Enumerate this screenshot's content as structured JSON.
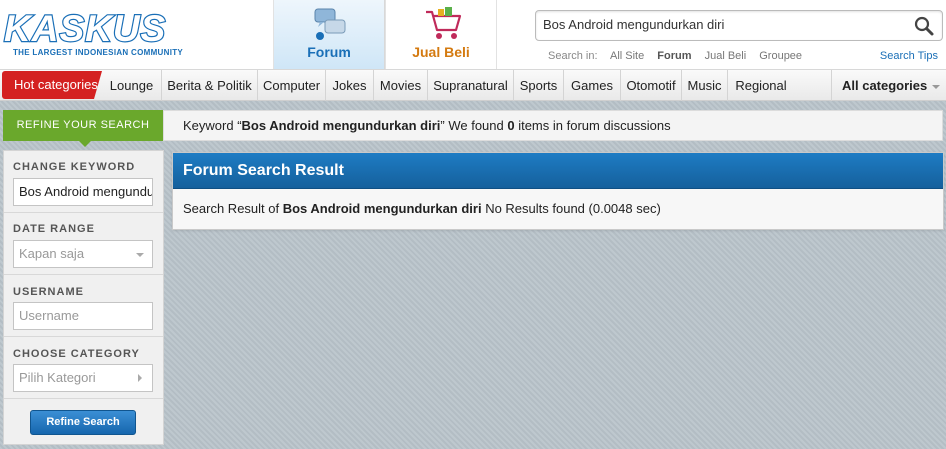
{
  "logo": {
    "wordmark": "KASKUS",
    "tagline": "THE LARGEST INDONESIAN COMMUNITY"
  },
  "nav_tabs": [
    {
      "label": "Forum",
      "active": true
    },
    {
      "label": "Jual Beli",
      "active": false
    }
  ],
  "search": {
    "value": "Bos Android mengundurkan diri",
    "search_in_label": "Search in:",
    "options": [
      {
        "label": "All Site",
        "active": false
      },
      {
        "label": "Forum",
        "active": true
      },
      {
        "label": "Jual Beli",
        "active": false
      },
      {
        "label": "Groupee",
        "active": false
      }
    ],
    "tips": "Search Tips"
  },
  "categories": {
    "hot": "Hot categories",
    "items": [
      "Lounge",
      "Berita & Politik",
      "Computer",
      "Jokes",
      "Movies",
      "Supranatural",
      "Sports",
      "Games",
      "Otomotif",
      "Music",
      "Regional"
    ],
    "all": "All categories"
  },
  "refine": {
    "tab_label": "REFINE YOUR SEARCH",
    "keyword_prefix": "Keyword “",
    "keyword": "Bos Android mengundurkan diri",
    "keyword_mid": "” We found ",
    "count": "0",
    "keyword_suffix": " items in forum discussions"
  },
  "sidebar": {
    "change_keyword_label": "CHANGE KEYWORD",
    "keyword_value": "Bos Android mengundurkan diri",
    "date_range_label": "DATE RANGE",
    "date_range_value": "Kapan saja",
    "username_label": "USERNAME",
    "username_placeholder": "Username",
    "category_label": "CHOOSE CATEGORY",
    "category_value": "Pilih Kategori",
    "refine_button": "Refine Search"
  },
  "results": {
    "title": "Forum Search Result",
    "prefix": "Search Result of ",
    "query": "Bos Android mengundurkan diri",
    "suffix": " No Results found (0.0048 sec)"
  },
  "colors": {
    "brand_blue": "#1a6fb7",
    "hot_red": "#d42121",
    "refine_green": "#6aa82c",
    "jualbeli_orange": "#d47a10"
  }
}
